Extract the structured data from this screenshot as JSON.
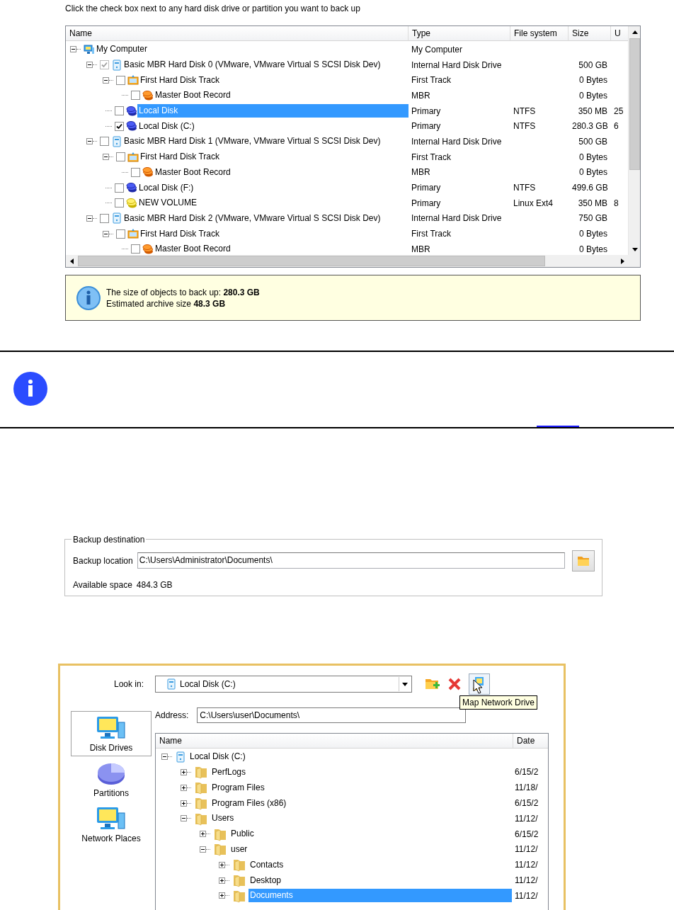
{
  "backup_selection": {
    "instruction": "Click the check box next to any hard disk drive or partition you want to back up",
    "columns": [
      "Name",
      "Type",
      "File system",
      "Size",
      "U"
    ],
    "tree": [
      {
        "kind": "computer",
        "name": "My Computer",
        "type": "My Computer",
        "selected": false,
        "expanded": true,
        "children": [
          {
            "kind": "disk",
            "name": "Basic MBR Hard Disk 0 (VMware, VMware Virtual S SCSI Disk Dev)",
            "type": "Internal Hard Disk Drive",
            "size": "500 GB",
            "checked": true,
            "dimmed": true,
            "selected": false,
            "expanded": true,
            "children": [
              {
                "kind": "track",
                "name": "First Hard Disk Track",
                "type": "First Track",
                "size": "0 Bytes",
                "checked": false,
                "dimmed": false,
                "selected": false,
                "expanded": true,
                "children": [
                  {
                    "kind": "mbr",
                    "name": "Master Boot Record",
                    "type": "MBR",
                    "size": "0 Bytes",
                    "checked": false,
                    "dimmed": false,
                    "selected": false
                  }
                ]
              },
              {
                "kind": "partition",
                "name": "Local Disk",
                "type": "Primary",
                "file_system": "NTFS",
                "size": "350 MB",
                "used": "25",
                "checked": false,
                "dimmed": false,
                "selected": true
              },
              {
                "kind": "partition",
                "name": "Local Disk (C:)",
                "type": "Primary",
                "file_system": "NTFS",
                "size": "280.3 GB",
                "used": "6",
                "checked": true,
                "dimmed": false,
                "selected": false
              }
            ]
          },
          {
            "kind": "disk",
            "name": "Basic MBR Hard Disk 1 (VMware, VMware Virtual S SCSI Disk Dev)",
            "type": "Internal Hard Disk Drive",
            "size": "500 GB",
            "checked": false,
            "dimmed": false,
            "selected": false,
            "expanded": true,
            "children": [
              {
                "kind": "track",
                "name": "First Hard Disk Track",
                "type": "First Track",
                "size": "0 Bytes",
                "checked": false,
                "dimmed": false,
                "selected": false,
                "expanded": true,
                "children": [
                  {
                    "kind": "mbr",
                    "name": "Master Boot Record",
                    "type": "MBR",
                    "size": "0 Bytes",
                    "checked": false,
                    "dimmed": false,
                    "selected": false
                  }
                ]
              },
              {
                "kind": "partition",
                "name": "Local Disk (F:)",
                "type": "Primary",
                "file_system": "NTFS",
                "size": "499.6 GB",
                "checked": false,
                "dimmed": false,
                "selected": false
              },
              {
                "kind": "linux",
                "name": "NEW VOLUME",
                "type": "Primary",
                "file_system": "Linux Ext4",
                "size": "350 MB",
                "used": "8",
                "checked": false,
                "dimmed": false,
                "selected": false
              }
            ]
          },
          {
            "kind": "disk",
            "name": "Basic MBR Hard Disk 2 (VMware, VMware Virtual S SCSI Disk Dev)",
            "type": "Internal Hard Disk Drive",
            "size": "750 GB",
            "checked": false,
            "dimmed": false,
            "selected": false,
            "expanded": true,
            "children": [
              {
                "kind": "track",
                "name": "First Hard Disk Track",
                "type": "First Track",
                "size": "0 Bytes",
                "checked": false,
                "dimmed": false,
                "selected": false,
                "expanded": true,
                "children": [
                  {
                    "kind": "mbr",
                    "name": "Master Boot Record",
                    "type": "MBR",
                    "size": "0 Bytes",
                    "checked": false,
                    "dimmed": false,
                    "selected": false
                  }
                ]
              }
            ]
          }
        ]
      }
    ],
    "summary": [
      "The size of objects to back up: **280.3 GB**",
      "Estimated archive size **48.3 GB**"
    ]
  },
  "backup_destination": {
    "legend": "Backup destination",
    "location_label": "Backup location",
    "location_value": "C:\\Users\\Administrator\\Documents\\",
    "space_label": "Available space",
    "space_value": "484.3 GB"
  },
  "open_dialog": {
    "look_in_label": "Look in:",
    "look_in_value": "Local Disk (C:)",
    "tooltip": "Map Network Drive",
    "address_label": "Address:",
    "address_value": "C:\\Users\\user\\Documents\\",
    "places": [
      {
        "kind": "drives",
        "label": "Disk Drives",
        "selected": true
      },
      {
        "kind": "partitions",
        "label": "Partitions",
        "selected": false
      },
      {
        "kind": "network",
        "label": "Network Places",
        "selected": false
      }
    ],
    "columns": [
      "Name",
      "Date"
    ],
    "tree": [
      {
        "kind": "drive",
        "name": "Local Disk (C:)",
        "selected": false,
        "expanded": true,
        "children": [
          {
            "kind": "folder",
            "name": "PerfLogs",
            "date": "6/15/2",
            "selected": false,
            "expanded": false
          },
          {
            "kind": "folder",
            "name": "Program Files",
            "date": "11/18/",
            "selected": false,
            "expanded": false
          },
          {
            "kind": "folder",
            "name": "Program Files (x86)",
            "date": "6/15/2",
            "selected": false,
            "expanded": false
          },
          {
            "kind": "folder",
            "name": "Users",
            "date": "11/12/",
            "selected": false,
            "expanded": true,
            "children": [
              {
                "kind": "folder",
                "name": "Public",
                "date": "6/15/2",
                "selected": false,
                "expanded": false
              },
              {
                "kind": "folder",
                "name": "user",
                "date": "11/12/",
                "selected": false,
                "expanded": true,
                "children": [
                  {
                    "kind": "folder",
                    "name": "Contacts",
                    "date": "11/12/",
                    "selected": false,
                    "expanded": false
                  },
                  {
                    "kind": "folder",
                    "name": "Desktop",
                    "date": "11/12/",
                    "selected": false,
                    "expanded": false
                  },
                  {
                    "kind": "folder",
                    "name": "Documents",
                    "date": "11/12/",
                    "selected": true,
                    "expanded": false
                  }
                ]
              }
            ]
          }
        ]
      }
    ]
  }
}
